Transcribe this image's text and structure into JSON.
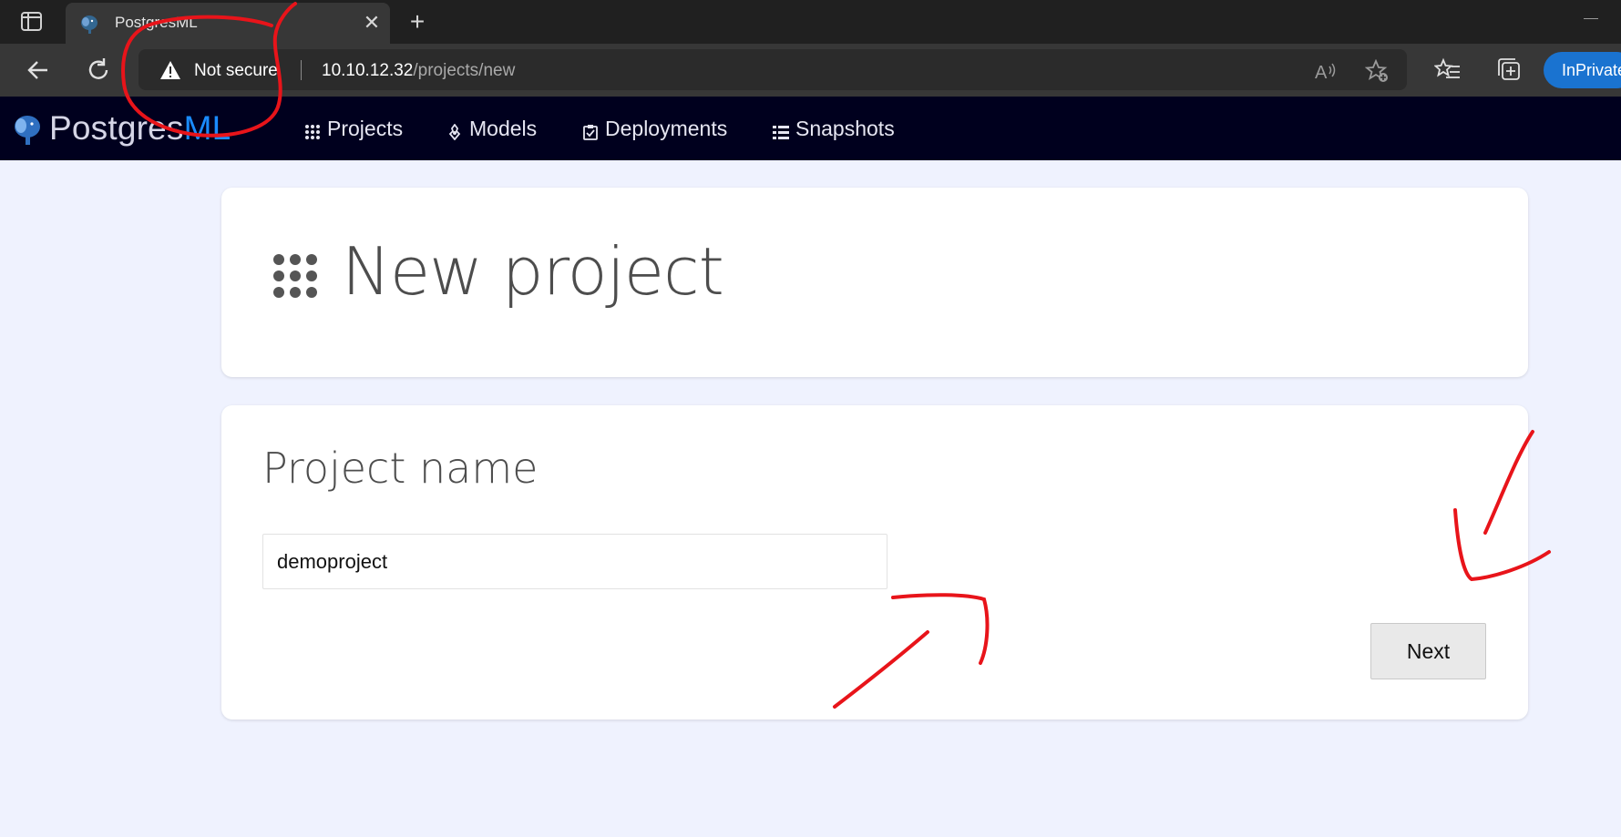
{
  "browser": {
    "tab": {
      "title": "PostgresML",
      "close_glyph": "✕"
    },
    "new_tab_glyph": "+",
    "address_bar": {
      "security_label": "Not secure",
      "url_host": "10.10.12.32",
      "url_path": "/projects/new"
    },
    "inprivate_label": "InPrivate"
  },
  "app": {
    "brand": {
      "name_main": "Postgres",
      "name_accent": "ML"
    },
    "nav": [
      {
        "label": "Projects",
        "icon": "grid-icon"
      },
      {
        "label": "Models",
        "icon": "model-icon"
      },
      {
        "label": "Deployments",
        "icon": "clipboard-check-icon"
      },
      {
        "label": "Snapshots",
        "icon": "list-icon"
      }
    ]
  },
  "page": {
    "title": "New project",
    "title_icon": "grid-icon",
    "form": {
      "label": "Project name",
      "input_value": "demoproject",
      "next_label": "Next"
    }
  },
  "colors": {
    "navbar_bg": "#00001e",
    "page_bg": "#eff2fe",
    "brand_accent": "#1a8cff",
    "annotation_red": "#e8141a",
    "inprivate_bg": "#1a73d0"
  }
}
